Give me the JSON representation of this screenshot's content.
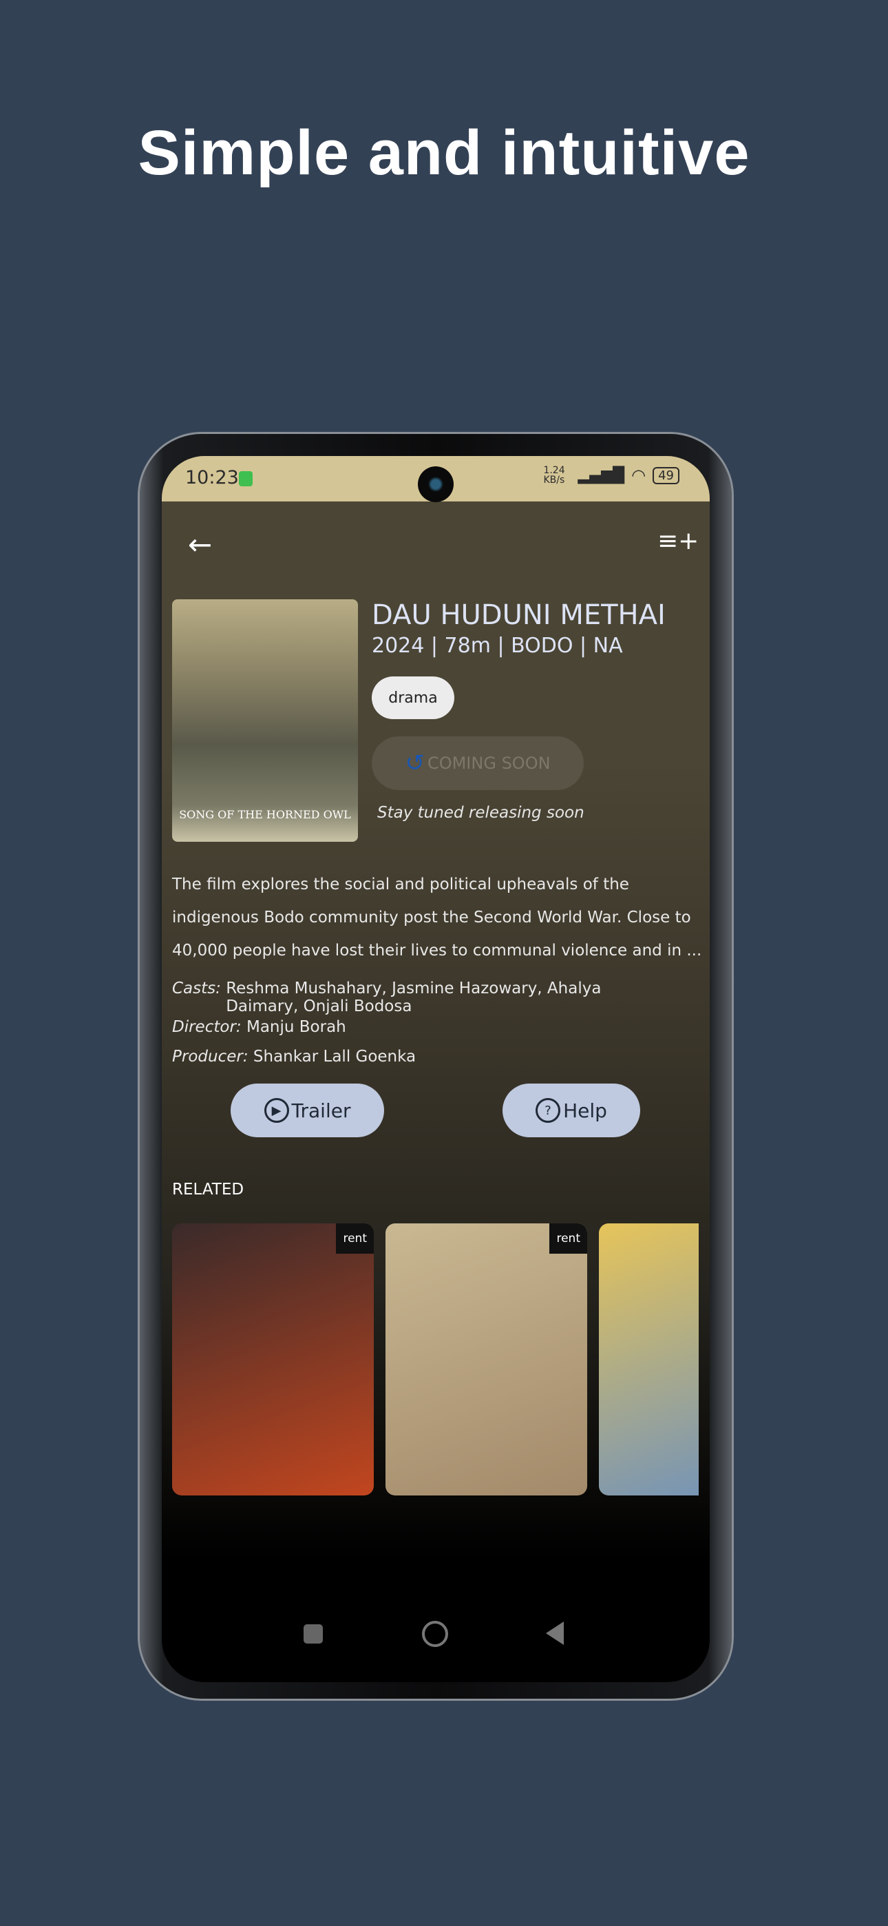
{
  "headline": "Simple and intuitive",
  "status": {
    "time": "10:23",
    "speed": "1.24 KB/s",
    "battery": "49"
  },
  "toolbar": {
    "back_icon": "arrow-left-icon",
    "add_icon": "playlist-add-icon"
  },
  "movie": {
    "title": "DAU HUDUNI METHAI",
    "meta": "2024 | 78m | BODO | NA",
    "genre": "drama",
    "coming_soon_label": "COMING SOON",
    "tagline": "Stay tuned releasing soon",
    "poster_text": "SONG OF THE HORNED OWL",
    "description": "The film explores the social and political upheavals of the indigenous Bodo community post the Second World War. Close to 40,000 people have lost their lives to communal violence and in ...",
    "casts_label": "Casts:",
    "casts": "Reshma Mushahary, Jasmine Hazowary, Ahalya Daimary, Onjali Bodosa",
    "director_label": "Director:",
    "director": "Manju Borah",
    "producer_label": "Producer:",
    "producer": "Shankar Lall Goenka",
    "trailer_label": "Trailer",
    "help_label": "Help"
  },
  "related": {
    "heading": "RELATED",
    "items": [
      {
        "badge": "rent",
        "colors": [
          "#3a2a2a",
          "#c2461f"
        ]
      },
      {
        "badge": "rent",
        "colors": [
          "#c9b892",
          "#a38a6a"
        ]
      },
      {
        "badge": "",
        "colors": [
          "#e6c45a",
          "#6a8fbf"
        ]
      }
    ]
  },
  "colors": {
    "status_bar": "#d4c596",
    "accent_button": "#bfc9df",
    "background": "#334155"
  }
}
